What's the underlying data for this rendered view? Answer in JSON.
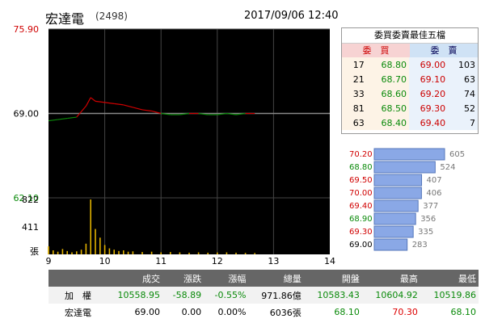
{
  "header": {
    "name": "宏達電",
    "code": "(2498)",
    "datetime": "2017/09/06 12:40"
  },
  "colors": {
    "up": "#d00000",
    "down": "#0a8a0a",
    "chart_bg": "#000000"
  },
  "chart_data": [
    {
      "type": "line",
      "title": "",
      "xlabel": "",
      "ylabel": "",
      "x_ticks": [
        "9",
        "10",
        "11",
        "12",
        "13",
        "14"
      ],
      "y_ticks": [
        "75.90",
        "69.00",
        "62.10"
      ],
      "ylim": [
        62.1,
        75.9
      ],
      "reference_price": 69.0,
      "grid": true,
      "x": [
        "09:00",
        "09:10",
        "09:20",
        "09:30",
        "09:40",
        "09:45",
        "09:50",
        "10:00",
        "10:10",
        "10:20",
        "10:30",
        "10:40",
        "10:50",
        "11:00",
        "11:10",
        "11:20",
        "11:30",
        "11:40",
        "11:50",
        "12:00",
        "12:10",
        "12:20",
        "12:30",
        "12:40"
      ],
      "values": [
        68.4,
        68.5,
        68.6,
        68.7,
        69.6,
        70.3,
        70.0,
        69.9,
        69.8,
        69.7,
        69.5,
        69.3,
        69.2,
        69.0,
        68.9,
        68.9,
        69.0,
        69.0,
        68.9,
        68.9,
        69.0,
        68.9,
        69.0,
        69.0
      ]
    },
    {
      "type": "bar",
      "title": "",
      "ylabel": "張",
      "y_ticks": [
        "822",
        "411"
      ],
      "ylim": [
        0,
        822
      ],
      "x": [
        "09:00",
        "09:05",
        "09:10",
        "09:15",
        "09:20",
        "09:25",
        "09:30",
        "09:35",
        "09:40",
        "09:45",
        "09:50",
        "09:55",
        "10:00",
        "10:05",
        "10:10",
        "10:15",
        "10:20",
        "10:25",
        "10:30",
        "10:40",
        "10:50",
        "11:00",
        "11:10",
        "11:20",
        "11:30",
        "11:40",
        "11:50",
        "12:00",
        "12:10",
        "12:20",
        "12:30",
        "12:40"
      ],
      "values": [
        120,
        60,
        40,
        80,
        50,
        30,
        45,
        70,
        160,
        822,
        380,
        250,
        140,
        90,
        70,
        50,
        60,
        40,
        45,
        35,
        40,
        30,
        35,
        30,
        25,
        30,
        25,
        28,
        30,
        25,
        22,
        20
      ]
    },
    {
      "type": "bar",
      "title": "",
      "categories": [
        "70.20",
        "68.80",
        "69.50",
        "70.00",
        "69.40",
        "68.90",
        "69.30",
        "69.00"
      ],
      "values": [
        605,
        524,
        407,
        406,
        377,
        356,
        335,
        283
      ]
    }
  ],
  "orderbook": {
    "title": "委買委賣最佳五檔",
    "bid_header": "委　買",
    "ask_header": "委　賣",
    "rows": [
      {
        "bid_size": "17",
        "bid_price": "68.80",
        "ask_price": "69.00",
        "ask_size": "103"
      },
      {
        "bid_size": "21",
        "bid_price": "68.70",
        "ask_price": "69.10",
        "ask_size": "63"
      },
      {
        "bid_size": "33",
        "bid_price": "68.60",
        "ask_price": "69.20",
        "ask_size": "74"
      },
      {
        "bid_size": "81",
        "bid_price": "68.50",
        "ask_price": "69.30",
        "ask_size": "52"
      },
      {
        "bid_size": "63",
        "bid_price": "68.40",
        "ask_price": "69.40",
        "ask_size": "7"
      }
    ]
  },
  "table": {
    "headers": [
      "",
      "成交",
      "漲跌",
      "漲幅",
      "總量",
      "開盤",
      "最高",
      "最低"
    ],
    "rows": [
      [
        "加　權",
        "10558.95",
        "-58.89",
        "-0.55%",
        "971.86億",
        "10583.43",
        "10604.92",
        "10519.86"
      ],
      [
        "宏達電",
        "69.00",
        "0.00",
        "0.00%",
        "6036張",
        "68.10",
        "70.30",
        "68.10"
      ]
    ]
  }
}
